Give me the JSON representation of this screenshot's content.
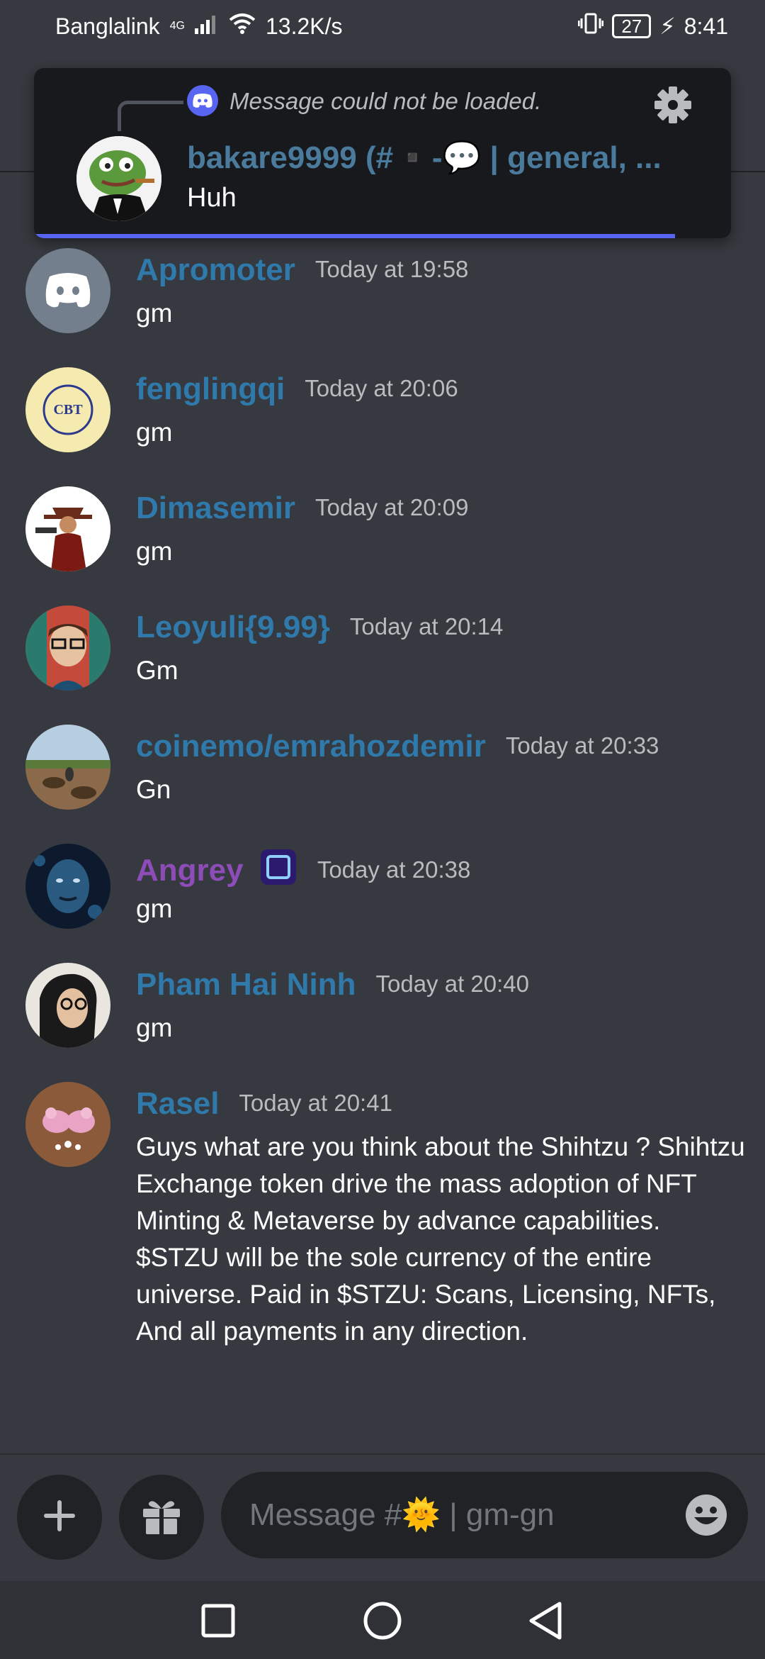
{
  "status_bar": {
    "carrier": "Banglalink",
    "network": "4G",
    "speed": "13.2K/s",
    "battery": "27",
    "time": "8:41"
  },
  "notification": {
    "reference_text": "Message could not be loaded.",
    "title": "bakare9999 (#▪️-💬 | general, ...",
    "body": "Huh",
    "progress": 0.92,
    "accent": "#5865f2"
  },
  "messages": [
    {
      "author": "Apromoter",
      "time": "Today at 19:58",
      "text": "gm",
      "name_color": "#2f79ab",
      "avatar": "discord-logo"
    },
    {
      "author": "fenglingqi",
      "time": "Today at 20:06",
      "text": "gm",
      "name_color": "#2f79ab",
      "avatar": "cbt-logo",
      "avatar_text": "CBT"
    },
    {
      "author": "Dimasemir",
      "time": "Today at 20:09",
      "text": "gm",
      "name_color": "#2f79ab",
      "avatar": "cowboy"
    },
    {
      "author": "Leoyuli{9.99}",
      "time": "Today at 20:14",
      "text": "Gm",
      "name_color": "#2f79ab",
      "avatar": "cartoon-man"
    },
    {
      "author": "coinemo/emrahozdemir",
      "time": "Today at 20:33",
      "text": "Gn",
      "name_color": "#2f79ab",
      "avatar": "landscape"
    },
    {
      "author": "Angrey",
      "time": "Today at 20:38",
      "text": "gm",
      "name_color": "#8e4cb8",
      "avatar": "blue-face",
      "badge": "role-badge-icon"
    },
    {
      "author": "Pham Hai Ninh",
      "time": "Today at 20:40",
      "text": "gm",
      "name_color": "#2f79ab",
      "avatar": "glasses-person"
    },
    {
      "author": "Rasel",
      "time": "Today at 20:41",
      "text": "Guys what are you think about the Shihtzu ? Shihtzu Exchange token drive the mass adoption of NFT Minting & Metaverse by advance capabilities. $STZU will be the sole currency of the entire universe. Paid in $STZU: Scans, Licensing, NFTs, And all payments in any direction.",
      "name_color": "#2f79ab",
      "avatar": "birds"
    }
  ],
  "composer": {
    "placeholder": "Message #🌞 | gm-gn",
    "add_icon": "plus-icon",
    "gift_icon": "gift-icon",
    "emoji_icon": "emoji-icon"
  },
  "nav": {
    "recents": "square-icon",
    "home": "circle-icon",
    "back": "triangle-back-icon"
  }
}
